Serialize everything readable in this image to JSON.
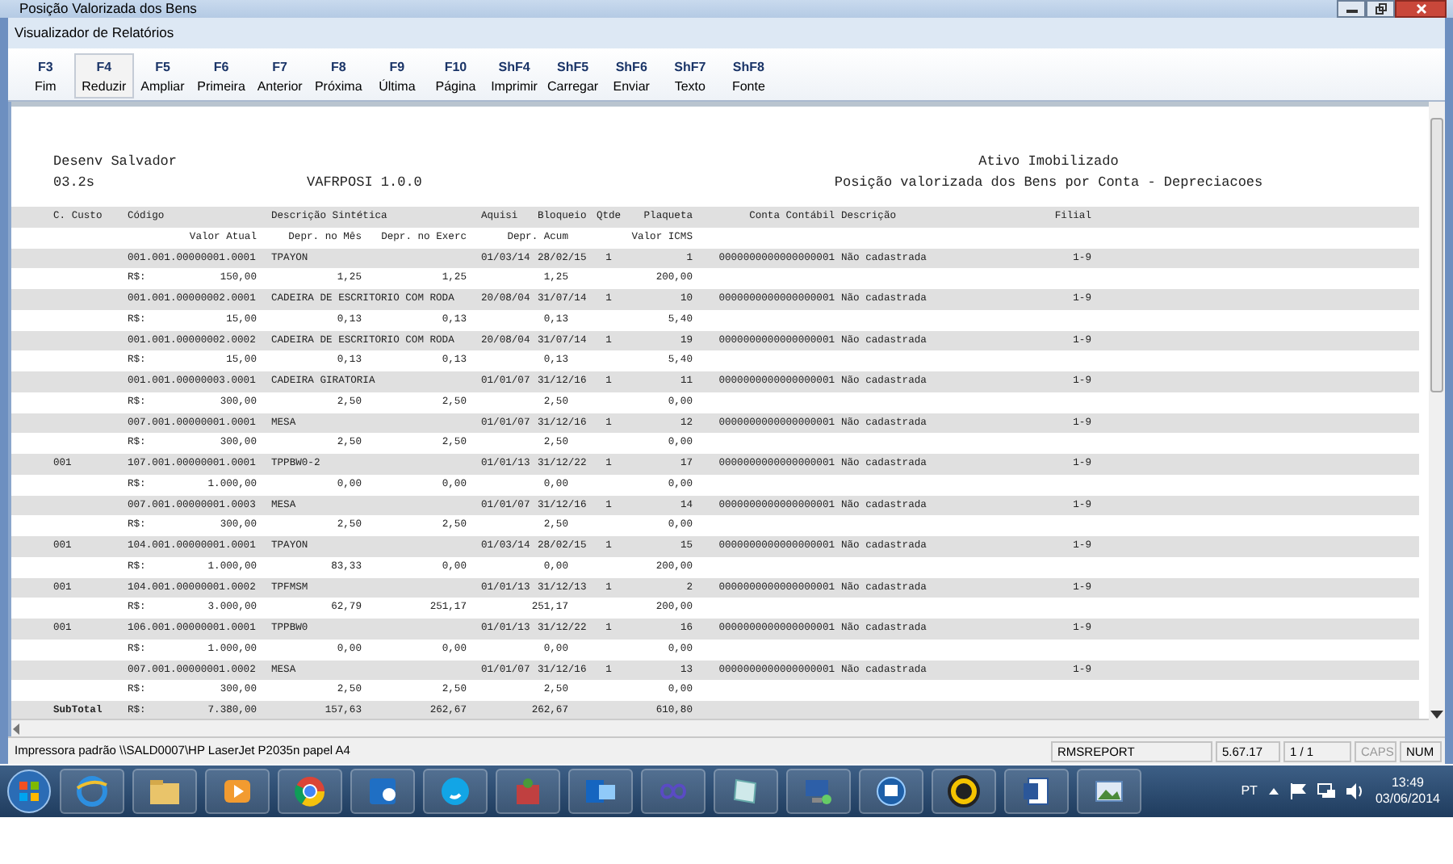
{
  "window": {
    "title": "Posição Valorizada dos Bens"
  },
  "viewer": {
    "title": "Visualizador de Relatórios"
  },
  "toolbar": [
    {
      "key": "F3",
      "label": "Fim",
      "highlighted": false
    },
    {
      "key": "F4",
      "label": "Reduzir",
      "highlighted": true
    },
    {
      "key": "F5",
      "label": "Ampliar",
      "highlighted": false
    },
    {
      "key": "F6",
      "label": "Primeira",
      "highlighted": false
    },
    {
      "key": "F7",
      "label": "Anterior",
      "highlighted": false
    },
    {
      "key": "F8",
      "label": "Próxima",
      "highlighted": false
    },
    {
      "key": "F9",
      "label": "Última",
      "highlighted": false
    },
    {
      "key": "F10",
      "label": "Página",
      "highlighted": false
    },
    {
      "key": "ShF4",
      "label": "Imprimir",
      "highlighted": false
    },
    {
      "key": "ShF5",
      "label": "Carregar",
      "highlighted": false
    },
    {
      "key": "ShF6",
      "label": "Enviar",
      "highlighted": false
    },
    {
      "key": "ShF7",
      "label": "Texto",
      "highlighted": false
    },
    {
      "key": "ShF8",
      "label": "Fonte",
      "highlighted": false
    }
  ],
  "report": {
    "header": {
      "company": "Desenv Salvador",
      "code": "03.2s",
      "program": "VAFRPOSI 1.0.0",
      "title": "Ativo Imobilizado",
      "subtitle": "Posição valorizada dos Bens por Conta - Depreciacoes"
    },
    "columns_line_1": [
      "C. Custo",
      "Código",
      "Descrição Sintética",
      "Aquisi",
      "Bloqueio",
      "Qtde",
      "Plaqueta",
      "Conta Contábil",
      "Descrição",
      "Filial"
    ],
    "columns_line_2": [
      "Valor Atual",
      "Depr. no Mês",
      "Depr. no Exerc",
      "Depr. Acum",
      "Valor ICMS"
    ],
    "items": [
      {
        "codigo": "001.001.00000001.0001",
        "descricao": "TPAYON",
        "aquisi": "01/03/14",
        "bloqueio": "28/02/15",
        "qtde": "1",
        "plaqueta": "1",
        "conta": "0000000000000000001",
        "conta_descricao": "Não cadastrada",
        "filial": "1-9",
        "currency": "R$:",
        "values": [
          "150,00",
          "1,25",
          "1,25",
          "1,25",
          "200,00"
        ]
      },
      {
        "codigo": "001.001.00000002.0001",
        "descricao": "CADEIRA DE ESCRITORIO COM RODA",
        "aquisi": "20/08/04",
        "bloqueio": "31/07/14",
        "qtde": "1",
        "plaqueta": "10",
        "conta": "0000000000000000001",
        "conta_descricao": "Não cadastrada",
        "filial": "1-9",
        "currency": "R$:",
        "values": [
          "15,00",
          "0,13",
          "0,13",
          "0,13",
          "5,40"
        ]
      },
      {
        "codigo": "001.001.00000002.0002",
        "descricao": "CADEIRA DE ESCRITORIO COM RODA",
        "aquisi": "20/08/04",
        "bloqueio": "31/07/14",
        "qtde": "1",
        "plaqueta": "19",
        "conta": "0000000000000000001",
        "conta_descricao": "Não cadastrada",
        "filial": "1-9",
        "currency": "R$:",
        "values": [
          "15,00",
          "0,13",
          "0,13",
          "0,13",
          "5,40"
        ]
      },
      {
        "codigo": "001.001.00000003.0001",
        "descricao": "CADEIRA GIRATORIA",
        "aquisi": "01/01/07",
        "bloqueio": "31/12/16",
        "qtde": "1",
        "plaqueta": "11",
        "conta": "0000000000000000001",
        "conta_descricao": "Não cadastrada",
        "filial": "1-9",
        "currency": "R$:",
        "values": [
          "300,00",
          "2,50",
          "2,50",
          "2,50",
          "0,00"
        ]
      },
      {
        "codigo": "007.001.00000001.0001",
        "descricao": "MESA",
        "aquisi": "01/01/07",
        "bloqueio": "31/12/16",
        "qtde": "1",
        "plaqueta": "12",
        "conta": "0000000000000000001",
        "conta_descricao": "Não cadastrada",
        "filial": "1-9",
        "currency": "R$:",
        "values": [
          "300,00",
          "2,50",
          "2,50",
          "2,50",
          "0,00"
        ]
      },
      {
        "c_custo": "001",
        "codigo": "107.001.00000001.0001",
        "descricao": "TPPBW0-2",
        "aquisi": "01/01/13",
        "bloqueio": "31/12/22",
        "qtde": "1",
        "plaqueta": "17",
        "conta": "0000000000000000001",
        "conta_descricao": "Não cadastrada",
        "filial": "1-9",
        "currency": "R$:",
        "values": [
          "1.000,00",
          "0,00",
          "0,00",
          "0,00",
          "0,00"
        ]
      },
      {
        "codigo": "007.001.00000001.0003",
        "descricao": "MESA",
        "aquisi": "01/01/07",
        "bloqueio": "31/12/16",
        "qtde": "1",
        "plaqueta": "14",
        "conta": "0000000000000000001",
        "conta_descricao": "Não cadastrada",
        "filial": "1-9",
        "currency": "R$:",
        "values": [
          "300,00",
          "2,50",
          "2,50",
          "2,50",
          "0,00"
        ]
      },
      {
        "c_custo": "001",
        "codigo": "104.001.00000001.0001",
        "descricao": "TPAYON",
        "aquisi": "01/03/14",
        "bloqueio": "28/02/15",
        "qtde": "1",
        "plaqueta": "15",
        "conta": "0000000000000000001",
        "conta_descricao": "Não cadastrada",
        "filial": "1-9",
        "currency": "R$:",
        "values": [
          "1.000,00",
          "83,33",
          "0,00",
          "0,00",
          "200,00"
        ]
      },
      {
        "c_custo": "001",
        "codigo": "104.001.00000001.0002",
        "descricao": "TPFMSM",
        "aquisi": "01/01/13",
        "bloqueio": "31/12/13",
        "qtde": "1",
        "plaqueta": "2",
        "conta": "0000000000000000001",
        "conta_descricao": "Não cadastrada",
        "filial": "1-9",
        "currency": "R$:",
        "values": [
          "3.000,00",
          "62,79",
          "251,17",
          "251,17",
          "200,00"
        ]
      },
      {
        "c_custo": "001",
        "codigo": "106.001.00000001.0001",
        "descricao": "TPPBW0",
        "aquisi": "01/01/13",
        "bloqueio": "31/12/22",
        "qtde": "1",
        "plaqueta": "16",
        "conta": "0000000000000000001",
        "conta_descricao": "Não cadastrada",
        "filial": "1-9",
        "currency": "R$:",
        "values": [
          "1.000,00",
          "0,00",
          "0,00",
          "0,00",
          "0,00"
        ]
      },
      {
        "codigo": "007.001.00000001.0002",
        "descricao": "MESA",
        "aquisi": "01/01/07",
        "bloqueio": "31/12/16",
        "qtde": "1",
        "plaqueta": "13",
        "conta": "0000000000000000001",
        "conta_descricao": "Não cadastrada",
        "filial": "1-9",
        "currency": "R$:",
        "values": [
          "300,00",
          "2,50",
          "2,50",
          "2,50",
          "0,00"
        ]
      }
    ],
    "subtotal": {
      "label": "SubTotal",
      "currency": "R$:",
      "values": [
        "7.380,00",
        "157,63",
        "262,67",
        "262,67",
        "610,80"
      ]
    }
  },
  "status_bar": {
    "printer": "Impressora padrão \\\\SALD0007\\HP LaserJet P2035n papel A4",
    "panels": [
      {
        "text": "RMSREPORT",
        "active": true
      },
      {
        "text": "5.67.17",
        "active": true
      },
      {
        "text": "1 / 1",
        "active": true
      },
      {
        "text": "CAPS",
        "active": false
      },
      {
        "text": "NUM",
        "active": true
      }
    ]
  },
  "taskbar": {
    "language": "PT",
    "time": "13:49",
    "date": "03/06/2014"
  }
}
